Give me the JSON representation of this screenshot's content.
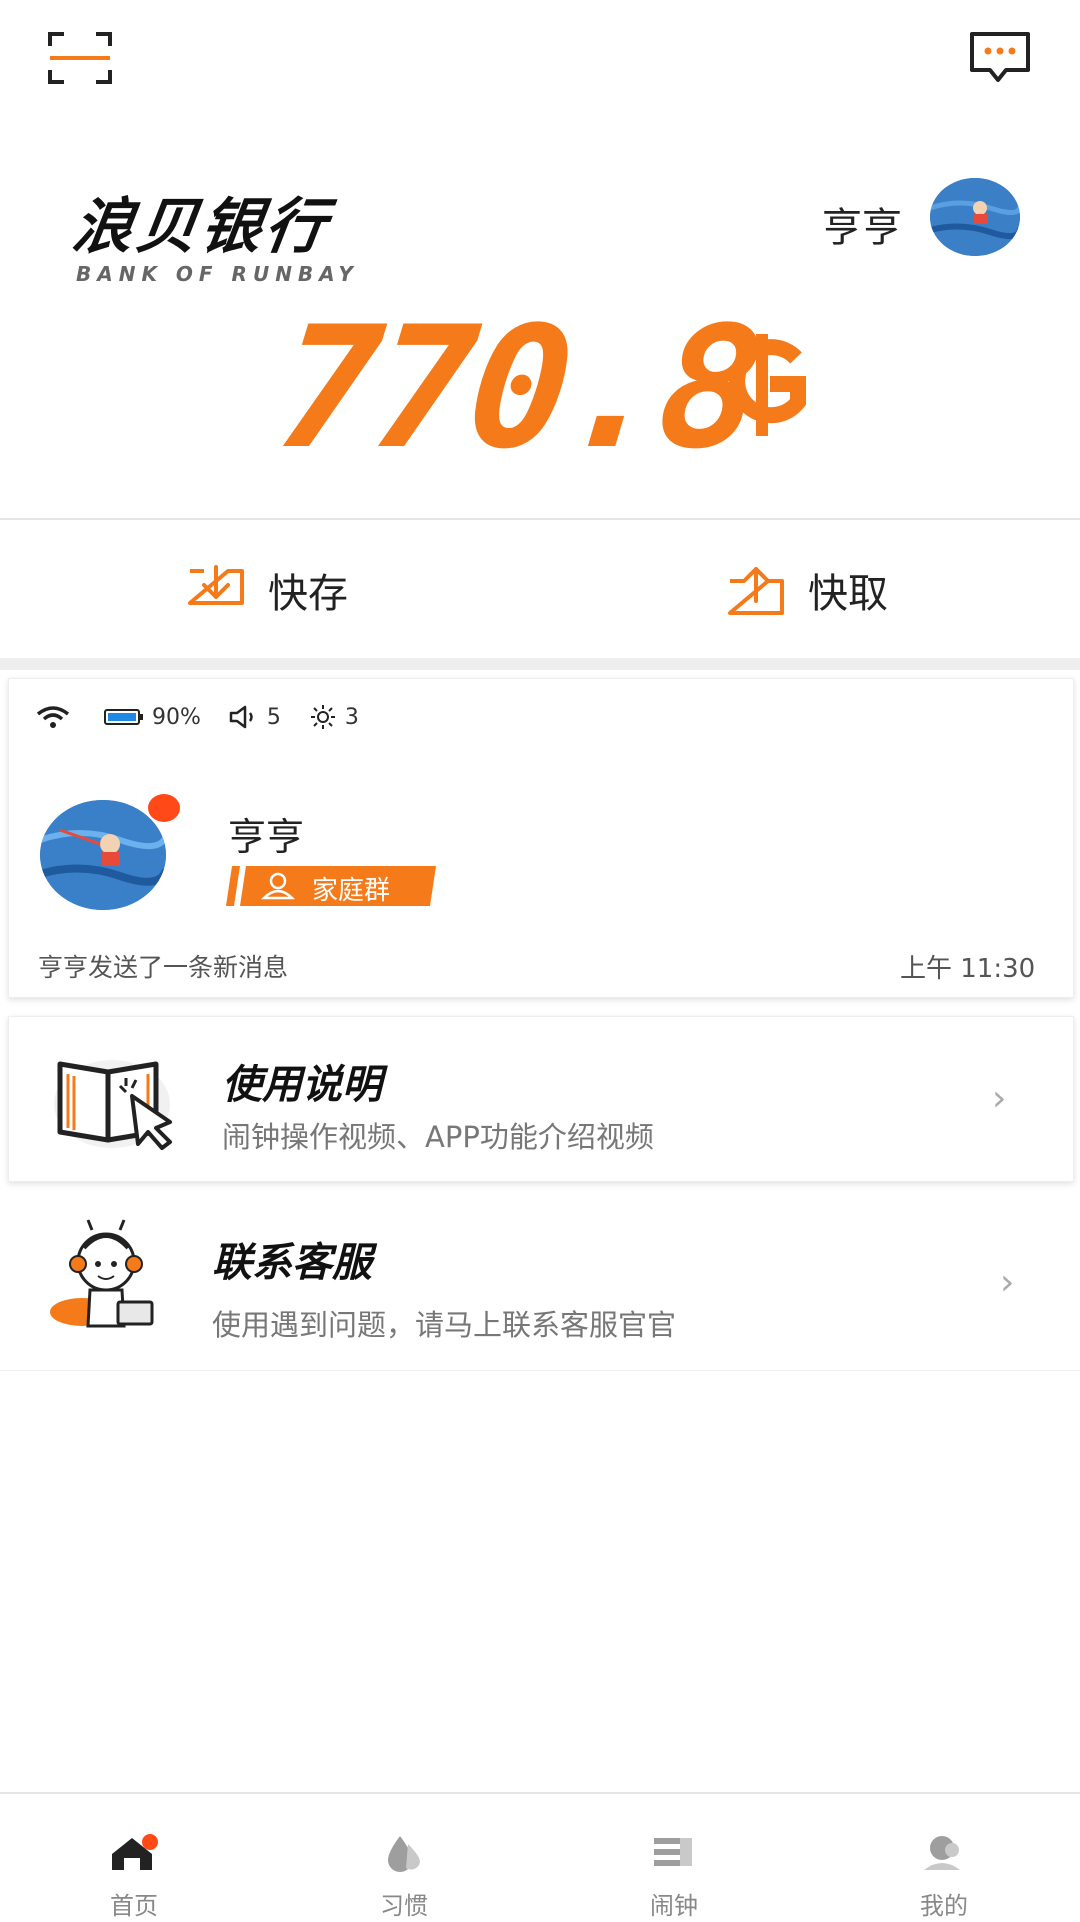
{
  "top_bar": {
    "scan_icon": "scan-icon",
    "message_icon": "chat-icon"
  },
  "brand": {
    "title": "浪贝银行",
    "subtitle": "BANK OF RUNBAY"
  },
  "user": {
    "name": "亨亨"
  },
  "balance": {
    "value": "770.8",
    "unit_icon": "coin-g-icon"
  },
  "actions": {
    "deposit_label": "快存",
    "withdraw_label": "快取"
  },
  "device_status": {
    "wifi": "wifi-icon",
    "battery": "90%",
    "volume": "5",
    "brightness": "3"
  },
  "message_card": {
    "sender": "亨亨",
    "tag": "家庭群",
    "preview": "亨亨发送了一条新消息",
    "time": "上午 11:30"
  },
  "guide": {
    "title": "使用说明",
    "description": "闹钟操作视频、APP功能介绍视频"
  },
  "service": {
    "title": "联系客服",
    "description": "使用遇到问题，请马上联系客服官官"
  },
  "nav": {
    "items": [
      {
        "label": "首页",
        "icon": "home-icon",
        "active": true
      },
      {
        "label": "习惯",
        "icon": "drop-icon"
      },
      {
        "label": "闹钟",
        "icon": "alarm-list-icon"
      },
      {
        "label": "我的",
        "icon": "profile-icon"
      }
    ]
  },
  "colors": {
    "accent": "#f47a1a",
    "badge": "#ff4a18"
  }
}
